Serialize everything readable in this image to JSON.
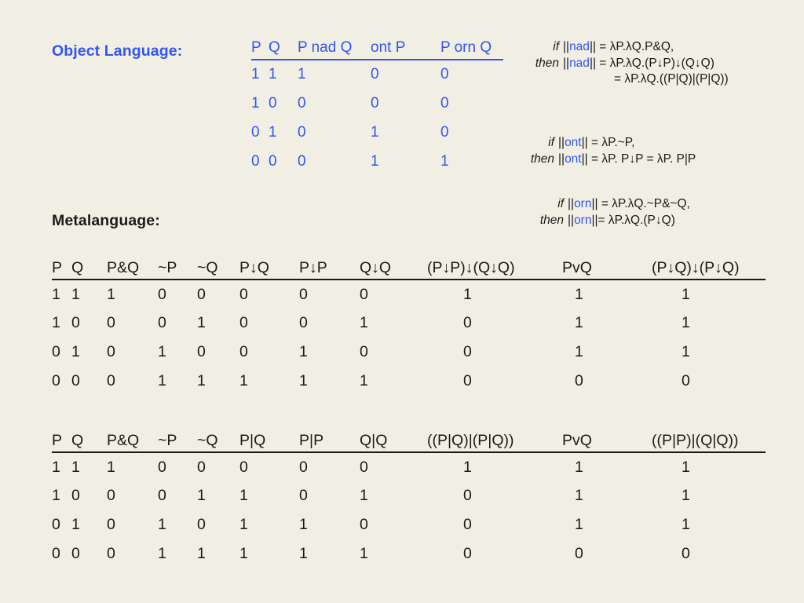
{
  "headings": {
    "object_language": "Object Language:",
    "metalanguage": "Metalanguage:"
  },
  "object_table": {
    "columns": [
      "P",
      "Q",
      "P nad Q",
      "ont P",
      "P orn Q"
    ],
    "rows": [
      [
        "1",
        "1",
        "1",
        "0",
        "0"
      ],
      [
        "1",
        "0",
        "0",
        "0",
        "0"
      ],
      [
        "0",
        "1",
        "0",
        "1",
        "0"
      ],
      [
        "0",
        "0",
        "0",
        "1",
        "1"
      ]
    ]
  },
  "meta_table_1": {
    "columns": [
      "P",
      "Q",
      "P&Q",
      "~P",
      "~Q",
      "P↓Q",
      "P↓P",
      "Q↓Q",
      "(P↓P)↓(Q↓Q)",
      "PvQ",
      "(P↓Q)↓(P↓Q)"
    ],
    "rows": [
      [
        "1",
        "1",
        "1",
        "0",
        "0",
        "0",
        "0",
        "0",
        "1",
        "1",
        "1"
      ],
      [
        "1",
        "0",
        "0",
        "0",
        "1",
        "0",
        "0",
        "1",
        "0",
        "1",
        "1"
      ],
      [
        "0",
        "1",
        "0",
        "1",
        "0",
        "0",
        "1",
        "0",
        "0",
        "1",
        "1"
      ],
      [
        "0",
        "0",
        "0",
        "1",
        "1",
        "1",
        "1",
        "1",
        "0",
        "0",
        "0"
      ]
    ]
  },
  "meta_table_2": {
    "columns": [
      "P",
      "Q",
      "P&Q",
      "~P",
      "~Q",
      "P|Q",
      "P|P",
      "Q|Q",
      "((P|Q)|(P|Q))",
      "PvQ",
      "((P|P)|(Q|Q))"
    ],
    "rows": [
      [
        "1",
        "1",
        "1",
        "0",
        "0",
        "0",
        "0",
        "0",
        "1",
        "1",
        "1"
      ],
      [
        "1",
        "0",
        "0",
        "0",
        "1",
        "1",
        "0",
        "1",
        "0",
        "1",
        "1"
      ],
      [
        "0",
        "1",
        "0",
        "1",
        "0",
        "1",
        "1",
        "0",
        "0",
        "1",
        "1"
      ],
      [
        "0",
        "0",
        "0",
        "1",
        "1",
        "1",
        "1",
        "1",
        "0",
        "0",
        "0"
      ]
    ]
  },
  "annotations": {
    "nad": {
      "line1_lead": "if",
      "line1_pre": "||",
      "line1_word": "nad",
      "line1_post": "|| = λP.λQ.P&Q,",
      "line2_lead": "then",
      "line2_pre": "||",
      "line2_word": "nad",
      "line2_post": "|| = λP.λQ.(P↓P)↓(Q↓Q)",
      "line3": "= λP.λQ.((P|Q)|(P|Q))"
    },
    "ont": {
      "line1_lead": "if",
      "line1_pre": "||",
      "line1_word": "ont",
      "line1_post": "|| =  λP.~P,",
      "line2_lead": "then",
      "line2_pre": "||",
      "line2_word": "ont",
      "line2_post": "|| = λP. P↓P  = λP. P|P"
    },
    "orn": {
      "line1_lead": "if",
      "line1_pre": "||",
      "line1_word": "orn",
      "line1_post": "|| = λP.λQ.~P&~Q,",
      "line2_lead": "then",
      "line2_pre": "||",
      "line2_word": "orn",
      "line2_post": "||= λP.λQ.(P↓Q)"
    }
  },
  "colors": {
    "background": "#f1efe3",
    "blue": "#3355ee",
    "black": "#1a1a1a"
  }
}
